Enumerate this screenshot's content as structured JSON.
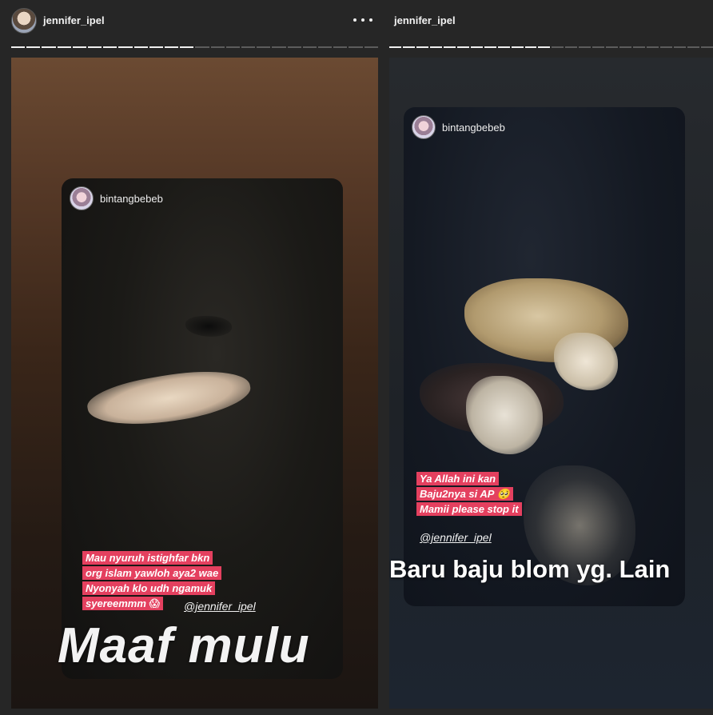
{
  "left": {
    "username": "jennifer_ipel",
    "progress": {
      "total": 24,
      "done": 12
    },
    "card": {
      "username": "bintangbebeb",
      "caption_lines": [
        "Mau nyuruh istighfar bkn",
        "org islam yawloh aya2 wae",
        "Nyonyah klo udh ngamuk",
        "syereemmm 😱"
      ],
      "mention": "@jennifer_ipel"
    },
    "overlay_text": "Maaf mulu"
  },
  "right": {
    "username": "jennifer_ipel",
    "progress": {
      "total": 24,
      "done": 12
    },
    "card": {
      "username": "bintangbebeb",
      "caption_lines": [
        "Ya Allah ini kan",
        "Baju2nya si AP 🥺",
        "Mamii please stop it"
      ],
      "mention": "@jennifer_ipel"
    },
    "overlay_text": "Baru baju blom yg. Lain"
  }
}
